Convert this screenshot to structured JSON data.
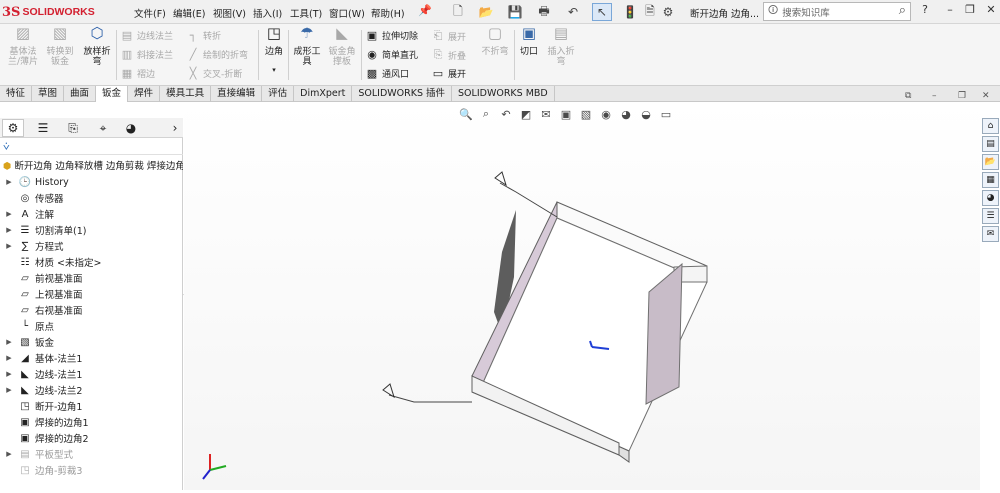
{
  "app": {
    "logo_mark": "3S",
    "logo_name": "SOLIDWORKS",
    "doc_title": "断开边角 边角...",
    "search_placeholder": "搜索知识库"
  },
  "menu": [
    "文件(F)",
    "编辑(E)",
    "视图(V)",
    "插入(I)",
    "工具(T)",
    "窗口(W)",
    "帮助(H)"
  ],
  "commands": {
    "base_flange": "基体法兰/薄片",
    "convert_to_sheet": "转换到钣金",
    "lofted_bend": "放样折弯",
    "edge_flange": "边线法兰",
    "miter_flange": "斜接法兰",
    "hem": "褶边",
    "jog": "转折",
    "sketched_bend": "绘制的折弯",
    "cross_break": "交叉-折断",
    "corners": "边角",
    "forming_tool": "成形工具",
    "sheet_metal_gusset": "钣金角撑板",
    "extruded_cut": "拉伸切除",
    "simple_hole": "简单直孔",
    "vent": "通风口",
    "unfold": "展开",
    "fold": "折叠",
    "flatten": "展开",
    "no_bends": "不折弯",
    "rip": "切口",
    "insert_bends": "插入折弯"
  },
  "tabs": [
    "特征",
    "草图",
    "曲面",
    "钣金",
    "焊件",
    "模具工具",
    "直接编辑",
    "评估",
    "DimXpert",
    "SOLIDWORKS 插件",
    "SOLIDWORKS MBD"
  ],
  "active_tab": "钣金",
  "tree": {
    "root": "断开边角 边角释放槽 边角剪裁 焊接边角 (",
    "items": [
      {
        "label": "History",
        "expandable": true,
        "greyed": false
      },
      {
        "label": "传感器",
        "expandable": false,
        "greyed": false
      },
      {
        "label": "注解",
        "expandable": true,
        "greyed": false
      },
      {
        "label": "切割清单(1)",
        "expandable": true,
        "greyed": false
      },
      {
        "label": "方程式",
        "expandable": true,
        "greyed": false
      },
      {
        "label": "材质 <未指定>",
        "expandable": false,
        "greyed": false
      },
      {
        "label": "前视基准面",
        "expandable": false,
        "greyed": false
      },
      {
        "label": "上视基准面",
        "expandable": false,
        "greyed": false
      },
      {
        "label": "右视基准面",
        "expandable": false,
        "greyed": false
      },
      {
        "label": "原点",
        "expandable": false,
        "greyed": false
      },
      {
        "label": "钣金",
        "expandable": true,
        "greyed": false
      },
      {
        "label": "基体-法兰1",
        "expandable": true,
        "greyed": false
      },
      {
        "label": "边线-法兰1",
        "expandable": true,
        "greyed": false
      },
      {
        "label": "边线-法兰2",
        "expandable": true,
        "greyed": false
      },
      {
        "label": "断开-边角1",
        "expandable": false,
        "greyed": false
      },
      {
        "label": "焊接的边角1",
        "expandable": false,
        "greyed": false
      },
      {
        "label": "焊接的边角2",
        "expandable": false,
        "greyed": false
      },
      {
        "label": "平板型式",
        "expandable": true,
        "greyed": true
      },
      {
        "label": "边角-剪裁3",
        "expandable": false,
        "greyed": true
      }
    ]
  },
  "colors": {
    "brand": "#d32030",
    "panel_bg": "#f5f5f5",
    "model_face": "#ffffff",
    "model_edge": "#6a6a6a",
    "model_shade": "#c8bcc8"
  }
}
